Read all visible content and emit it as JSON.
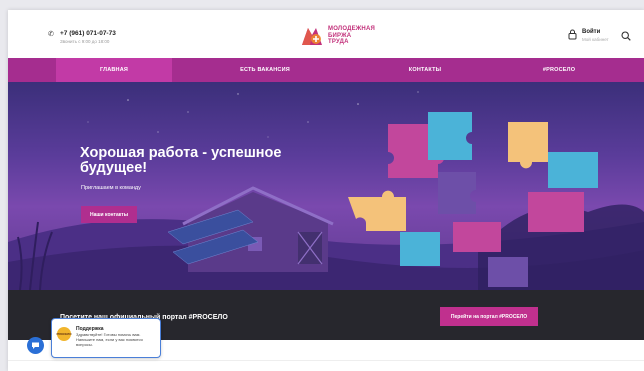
{
  "header": {
    "phone": "+7 (961) 071-07-73",
    "phone_sub": "Звонить с 9:00 до 18:00",
    "logo_lines": [
      "МОЛОДЕЖНАЯ",
      "БИРЖА",
      "ТРУДА"
    ],
    "login_title": "Войти",
    "login_sub": "Мой кабинет"
  },
  "nav": {
    "items": [
      "ГЛАВНАЯ",
      "ЕСТЬ ВАКАНСИЯ",
      "КОНТАКТЫ",
      "#PROCEЛО"
    ]
  },
  "hero": {
    "title": "Хорошая работа - успешное будущее!",
    "subtitle": "Приглашаем в команду",
    "button": "Наши контакты"
  },
  "portal": {
    "text": "Посетите наш официальный портал #PROCEЛО",
    "button": "Перейти на портал #PROCEЛО"
  },
  "chat": {
    "title": "Поддержка",
    "message": "Здравствуйте! Готовы помочь вам. Напишите нам, если у вас появятся вопросы.",
    "avatar_text": "PROCEЛО"
  },
  "colors": {
    "brand": "#a52d8f",
    "accent": "#c0308e",
    "dark_bar": "#27272d",
    "chat_blue": "#2a6fd6"
  }
}
